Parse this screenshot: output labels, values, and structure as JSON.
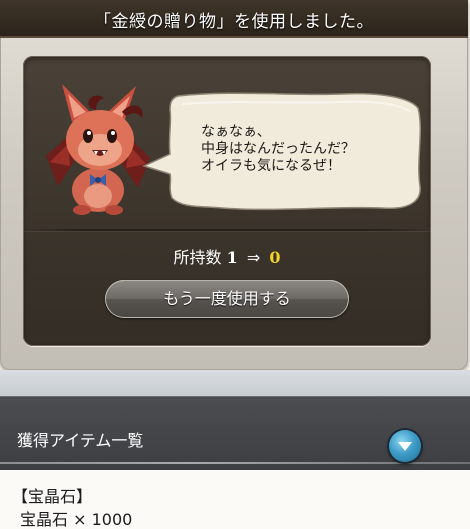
{
  "popup": {
    "title": "「金綬の贈り物」を使用しました。",
    "speech_lines": [
      "なぁなぁ、",
      "中身はなんだったんだ？",
      "オイラも気になるぜ！"
    ],
    "count_label": "所持数",
    "count_before": "1",
    "count_arrow": "⇒",
    "count_after": "0",
    "use_again_label": "もう一度使用する",
    "character_icon": "red-dragon-mascot"
  },
  "obtained": {
    "title": "獲得アイテム一覧",
    "expand_icon": "chevron-down-icon",
    "category": "【宝晶石】",
    "items": [
      {
        "name": "宝晶石",
        "quantity": "× 1000"
      }
    ]
  },
  "colors": {
    "count_after": "#f4d32a",
    "expand_button": "#3f9cc8",
    "panel": "#3c352c"
  }
}
